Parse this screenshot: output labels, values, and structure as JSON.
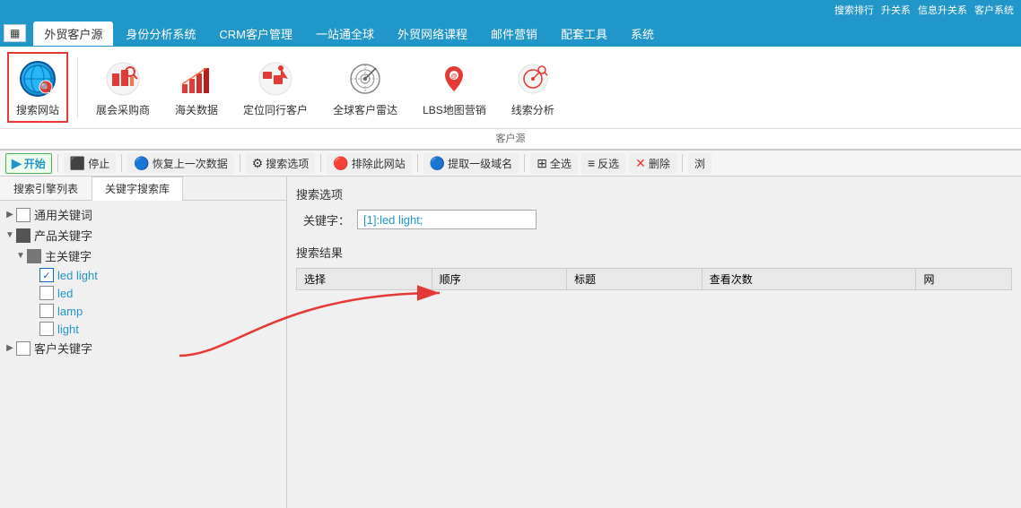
{
  "topbar": {
    "links": [
      "搜索排行",
      "升关系",
      "信息升关系",
      "客户系统"
    ]
  },
  "tabs": {
    "grid_btn": "▦",
    "items": [
      {
        "label": "外贸客户源",
        "active": true
      },
      {
        "label": "身份分析系统",
        "active": false
      },
      {
        "label": "CRM客户管理",
        "active": false
      },
      {
        "label": "一站通全球",
        "active": false
      },
      {
        "label": "外贸网络课程",
        "active": false
      },
      {
        "label": "邮件营销",
        "active": false
      },
      {
        "label": "配套工具",
        "active": false
      },
      {
        "label": "系统",
        "active": false
      }
    ]
  },
  "ribbon": {
    "icons": [
      {
        "id": "search-website",
        "label": "搜索网站",
        "selected": true
      },
      {
        "id": "exhibition",
        "label": "展会采购商",
        "selected": false
      },
      {
        "id": "customs",
        "label": "海关数据",
        "selected": false
      },
      {
        "id": "locate",
        "label": "定位同行客户",
        "selected": false
      },
      {
        "id": "radar",
        "label": "全球客户雷达",
        "selected": false
      },
      {
        "id": "lbs",
        "label": "LBS地图营销",
        "selected": false
      },
      {
        "id": "analysis",
        "label": "线索分析",
        "selected": false
      }
    ],
    "group_label": "客户源"
  },
  "toolbar": {
    "buttons": [
      {
        "id": "start",
        "label": "开始",
        "icon": "▶",
        "class": "start"
      },
      {
        "id": "stop",
        "label": "停止",
        "icon": "⬛",
        "class": ""
      },
      {
        "id": "restore",
        "label": "恢复上一次数据",
        "icon": "🔵",
        "class": ""
      },
      {
        "id": "search-options",
        "label": "搜索选项",
        "icon": "⚙",
        "class": ""
      },
      {
        "id": "exclude",
        "label": "排除此网站",
        "icon": "🔴",
        "class": ""
      },
      {
        "id": "extract",
        "label": "提取一级域名",
        "icon": "🔵",
        "class": ""
      },
      {
        "id": "select-all",
        "label": "全选",
        "icon": "⊞",
        "class": ""
      },
      {
        "id": "inverse",
        "label": "反选",
        "icon": "≡",
        "class": ""
      },
      {
        "id": "delete",
        "label": "删除",
        "icon": "✕",
        "class": ""
      },
      {
        "id": "more",
        "label": "浏",
        "icon": "",
        "class": ""
      }
    ]
  },
  "left_panel": {
    "tabs": [
      {
        "label": "搜索引擎列表",
        "active": false
      },
      {
        "label": "关键字搜索库",
        "active": true
      }
    ],
    "tree": [
      {
        "level": 0,
        "arrow": "▶",
        "checkbox": false,
        "checked": false,
        "partial": false,
        "label": "通用关键词",
        "color": "black"
      },
      {
        "level": 0,
        "arrow": "▼",
        "checkbox": true,
        "checked": false,
        "partial": true,
        "label": "产品关键字",
        "color": "black"
      },
      {
        "level": 1,
        "arrow": "▼",
        "checkbox": true,
        "checked": false,
        "partial": true,
        "label": "主关键字",
        "color": "black"
      },
      {
        "level": 2,
        "arrow": "",
        "checkbox": true,
        "checked": true,
        "partial": false,
        "label": "led light",
        "color": "blue"
      },
      {
        "level": 2,
        "arrow": "",
        "checkbox": true,
        "checked": false,
        "partial": false,
        "label": "led",
        "color": "blue"
      },
      {
        "level": 2,
        "arrow": "",
        "checkbox": true,
        "checked": false,
        "partial": false,
        "label": "lamp",
        "color": "blue"
      },
      {
        "level": 2,
        "arrow": "",
        "checkbox": true,
        "checked": false,
        "partial": false,
        "label": "light",
        "color": "blue"
      },
      {
        "level": 0,
        "arrow": "▶",
        "checkbox": true,
        "checked": false,
        "partial": false,
        "label": "客户关键字",
        "color": "black"
      }
    ]
  },
  "right_panel": {
    "search_options_title": "搜索选项",
    "keyword_label": "关键字：",
    "keyword_value": "[1]:led light;",
    "results_title": "搜索结果",
    "columns": [
      "选择",
      "顺序",
      "标题",
      "查看次数",
      "网"
    ]
  },
  "arrows": {
    "arrow1": {
      "color": "#e53935"
    }
  }
}
